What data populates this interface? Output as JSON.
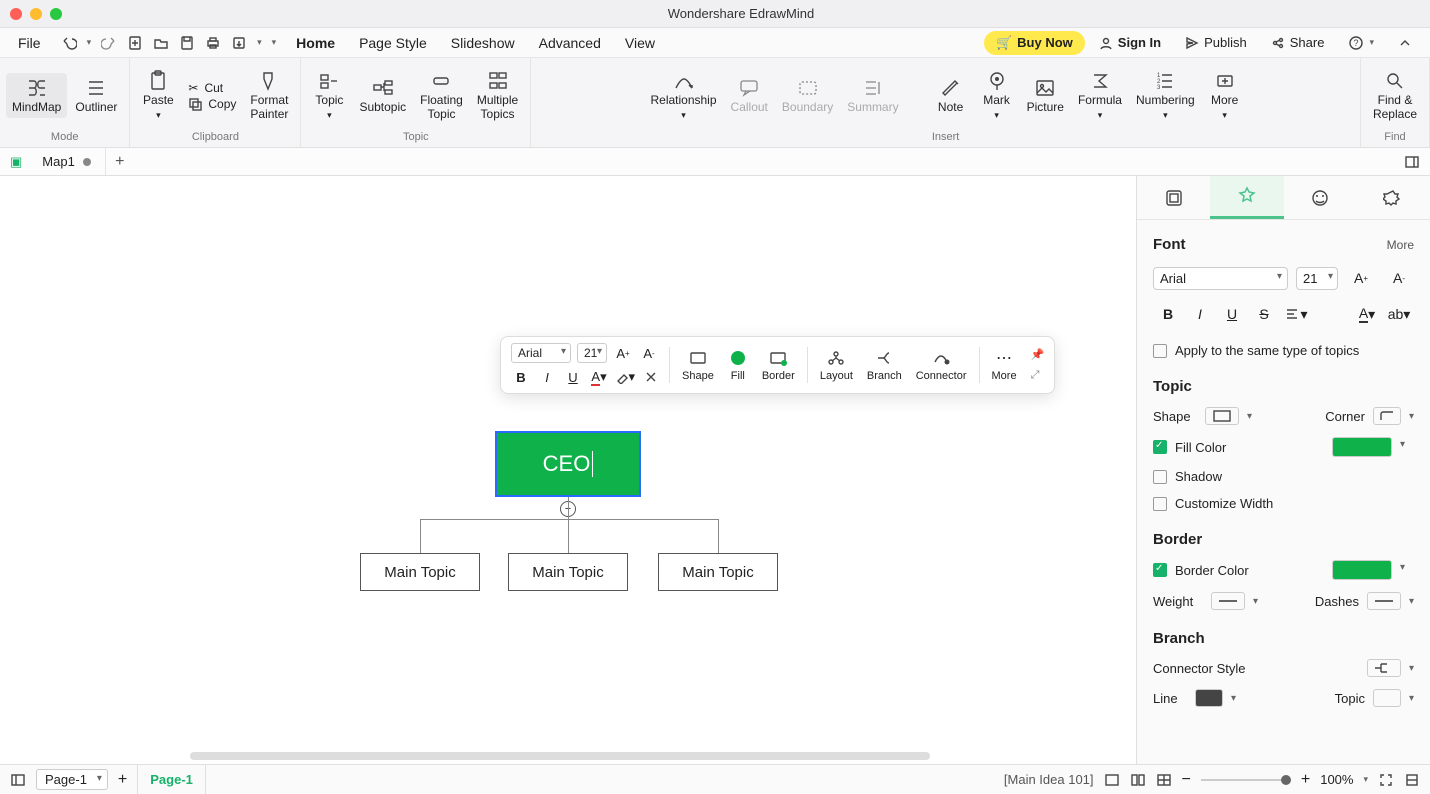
{
  "app_title": "Wondershare EdrawMind",
  "menubar": {
    "file": "File",
    "tabs": [
      "Home",
      "Page Style",
      "Slideshow",
      "Advanced",
      "View"
    ],
    "active_tab": "Home",
    "buy_now": "Buy Now",
    "sign_in": "Sign In",
    "publish": "Publish",
    "share": "Share"
  },
  "ribbon": {
    "mode": {
      "label": "Mode",
      "mindmap": "MindMap",
      "outliner": "Outliner"
    },
    "clipboard": {
      "label": "Clipboard",
      "paste": "Paste",
      "cut": "Cut",
      "copy": "Copy",
      "format_painter": "Format\nPainter"
    },
    "topic": {
      "label": "Topic",
      "topic": "Topic",
      "subtopic": "Subtopic",
      "floating": "Floating\nTopic",
      "multiple": "Multiple\nTopics"
    },
    "insert": {
      "label": "Insert",
      "relationship": "Relationship",
      "callout": "Callout",
      "boundary": "Boundary",
      "summary": "Summary",
      "note": "Note",
      "mark": "Mark",
      "picture": "Picture",
      "formula": "Formula",
      "numbering": "Numbering",
      "more": "More"
    },
    "find": {
      "label": "Find",
      "find_replace": "Find &\nReplace"
    }
  },
  "doc_tab": {
    "name": "Map1"
  },
  "mini_toolbar": {
    "font": "Arial",
    "size": "21",
    "shape": "Shape",
    "fill": "Fill",
    "border": "Border",
    "layout": "Layout",
    "branch": "Branch",
    "connector": "Connector",
    "more": "More"
  },
  "nodes": {
    "root": "CEO",
    "children": [
      "Main Topic",
      "Main Topic",
      "Main Topic"
    ]
  },
  "panel": {
    "font": {
      "title": "Font",
      "more": "More",
      "family": "Arial",
      "size": "21",
      "apply_same": "Apply to the same type of topics"
    },
    "topic": {
      "title": "Topic",
      "shape": "Shape",
      "corner": "Corner",
      "fill_color": "Fill Color",
      "shadow": "Shadow",
      "customize_width": "Customize Width"
    },
    "border": {
      "title": "Border",
      "border_color": "Border Color",
      "weight": "Weight",
      "dashes": "Dashes"
    },
    "branch": {
      "title": "Branch",
      "connector_style": "Connector Style",
      "line": "Line",
      "topic": "Topic"
    },
    "fill_color_value": "#0fb24a",
    "border_color_value": "#0fb24a"
  },
  "status": {
    "page_select": "Page-1",
    "page_tab": "Page-1",
    "selection_info": "[Main Idea 101]",
    "zoom": "100%"
  }
}
